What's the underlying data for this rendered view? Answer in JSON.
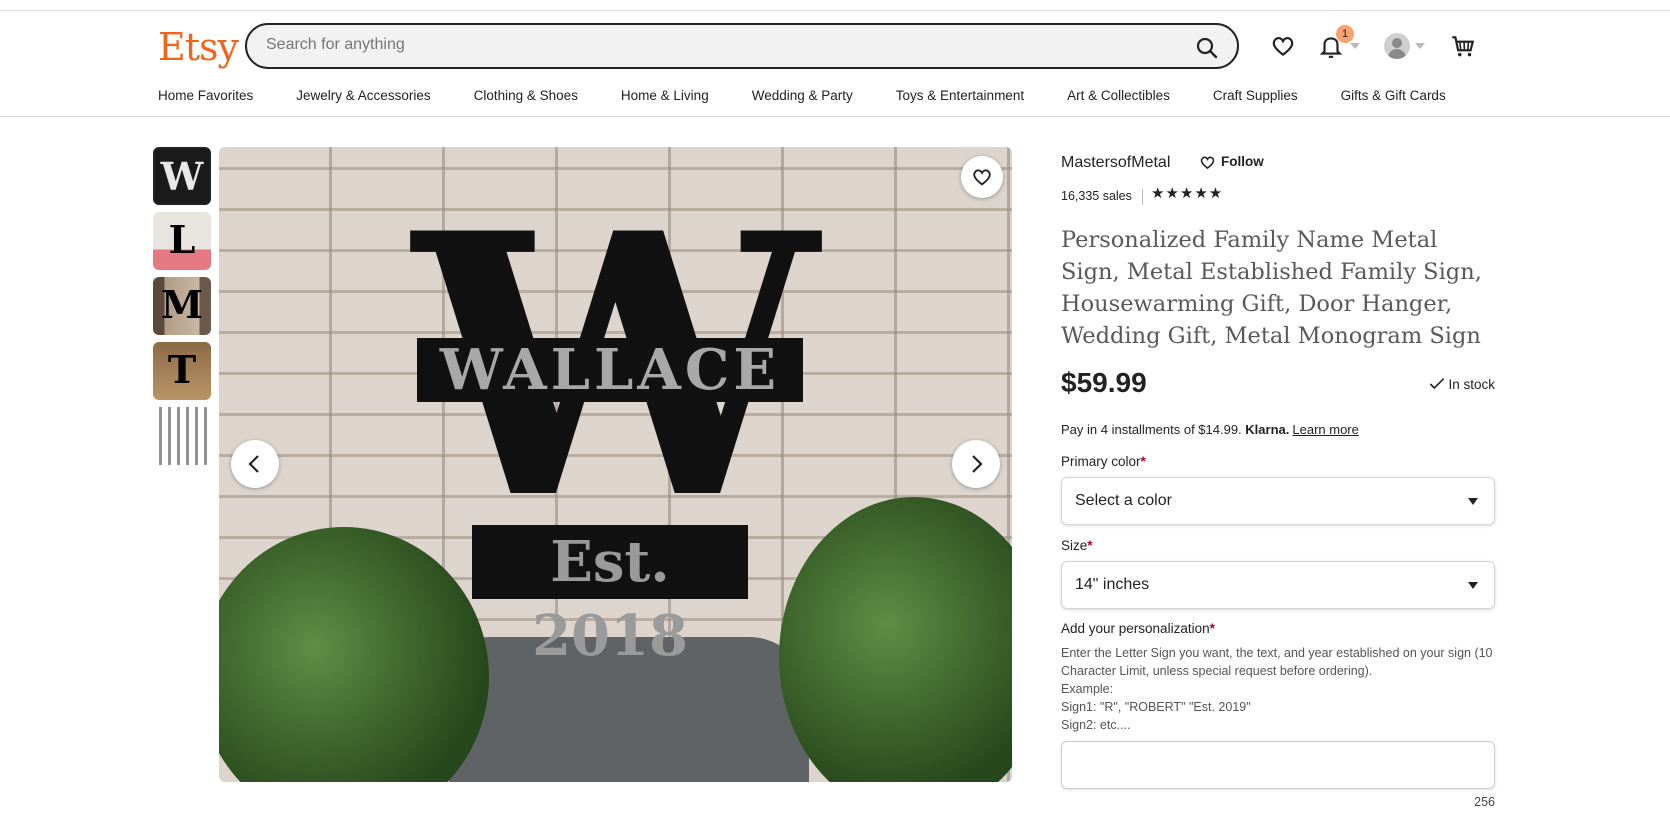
{
  "header": {
    "logo": "Etsy",
    "search_placeholder": "Search for anything",
    "notification_count": "1",
    "categories": [
      "Home Favorites",
      "Jewelry & Accessories",
      "Clothing & Shoes",
      "Home & Living",
      "Wedding & Party",
      "Toys & Entertainment",
      "Art & Collectibles",
      "Craft Supplies",
      "Gifts & Gift Cards"
    ]
  },
  "gallery": {
    "thumb_letters": [
      "W",
      "L",
      "M",
      "T",
      ""
    ],
    "hero": {
      "monogram": "W",
      "name": "WALLACE",
      "established": "Est. 2018"
    }
  },
  "listing": {
    "shop_name": "MastersofMetal",
    "follow_label": "Follow",
    "sales": "16,335 sales",
    "stars": "★★★★★",
    "title": "Personalized Family Name Metal Sign, Metal Established Family Sign, Housewarming Gift, Door Hanger, Wedding Gift, Metal Monogram Sign",
    "price": "$59.99",
    "stock": "In stock",
    "pay_text": "Pay in 4 installments of $14.99.",
    "pay_brand": "Klarna.",
    "pay_link": "Learn more",
    "primary_color_label": "Primary color",
    "primary_color_value": "Select a color",
    "size_label": "Size",
    "size_value": "14\" inches",
    "personalization_label": "Add your personalization",
    "personalization_instructions": "Enter the Letter Sign you want, the text, and year established on your sign (10 Character Limit, unless special request before ordering).\nExample:\nSign1: \"R\", \"ROBERT\" \"Est. 2019\"\nSign2: etc....",
    "char_count": "256",
    "required_mark": "*"
  },
  "colors": {
    "brand": "#f1641e",
    "required": "#b0002b"
  }
}
